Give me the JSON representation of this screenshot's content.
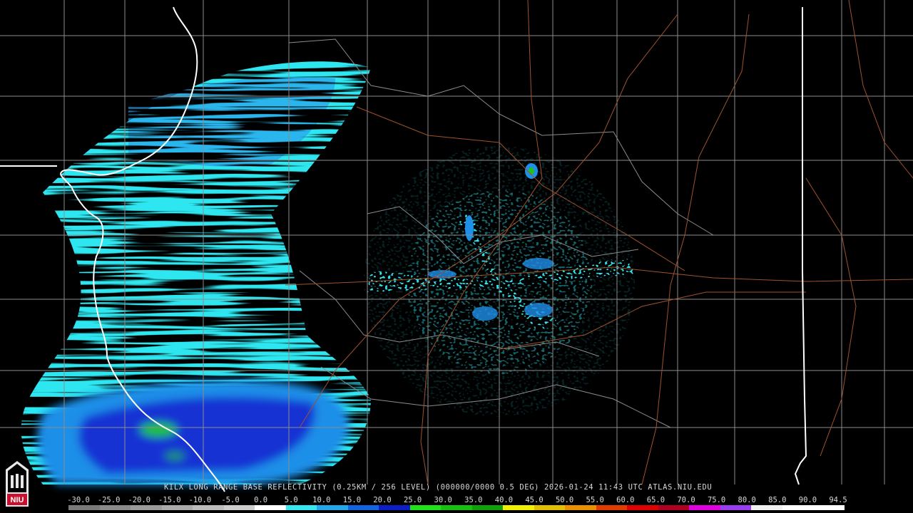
{
  "caption": "KILX LONG RANGE BASE REFLECTIVITY (0.25KM / 256 LEVEL) (000000/0000 0.5 DEG) 2026-01-24 11:43 UTC  ATLAS.NIU.EDU",
  "logo": {
    "text": "NIU",
    "bg": "#c8102e"
  },
  "colors": {
    "background": "#000000",
    "county_lines": "#8c8c8c",
    "state_lines": "#ffffff",
    "highways": "#a0522d",
    "echo_light": "#2ee6f0",
    "echo_mid": "#1f8fe8",
    "echo_dark": "#1428d0",
    "echo_green": "#22c21a"
  },
  "scale": {
    "labels": [
      "-30.0",
      "-25.0",
      "-20.0",
      "-15.0",
      "-10.0",
      "-5.0",
      "0.0",
      "5.0",
      "10.0",
      "15.0",
      "20.0",
      "25.0",
      "30.0",
      "35.0",
      "40.0",
      "45.0",
      "50.0",
      "55.0",
      "60.0",
      "65.0",
      "70.0",
      "75.0",
      "80.0",
      "85.0",
      "90.0",
      "94.5"
    ],
    "colors": [
      "#7a7a7a",
      "#8a8a8a",
      "#9a9a9a",
      "#aaaaaa",
      "#bcbcbc",
      "#cccccc",
      "#ffffff",
      "#36e6f0",
      "#22a8ea",
      "#1464e0",
      "#0c1ec8",
      "#22e01a",
      "#18c012",
      "#10a00c",
      "#f0f000",
      "#e0c000",
      "#e89000",
      "#e03c00",
      "#e00000",
      "#b00020",
      "#e000e0",
      "#9a3cf0",
      "#f0f0f0",
      "#ffffff",
      "#ffffff"
    ]
  }
}
